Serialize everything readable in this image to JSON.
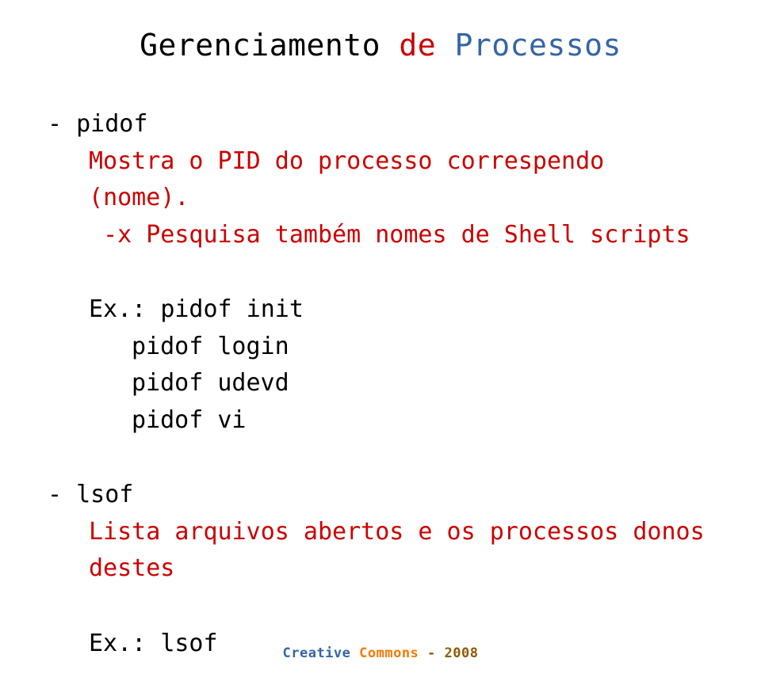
{
  "heading": {
    "part1": "Gerenciamento ",
    "part2": "de ",
    "part3": "Processos"
  },
  "section1": {
    "dash": "- ",
    "cmd": "pidof",
    "line1_a": "Mostra o PID do processo correspendo ",
    "line1_b": "(",
    "line1_c": "nome",
    "line1_d": ").",
    "line2_a": "-",
    "line2_b": "x Pesquisa também nomes de Shell scripts"
  },
  "examples1": {
    "prefix": "Ex",
    "dot": ".: ",
    "l1": "pidof init",
    "l2": "pidof login",
    "l3": "pidof udevd",
    "l4": "pidof vi"
  },
  "section2": {
    "dash": "- ",
    "cmd": "lsof",
    "desc": "Lista arquivos abertos e os processos donos destes"
  },
  "examples2": {
    "prefix": "Ex",
    "dot": ".: ",
    "l1": "lsof"
  },
  "footer": {
    "part1": "Creative ",
    "part2": "Commons ",
    "part3": "- ",
    "part4": "2008"
  }
}
